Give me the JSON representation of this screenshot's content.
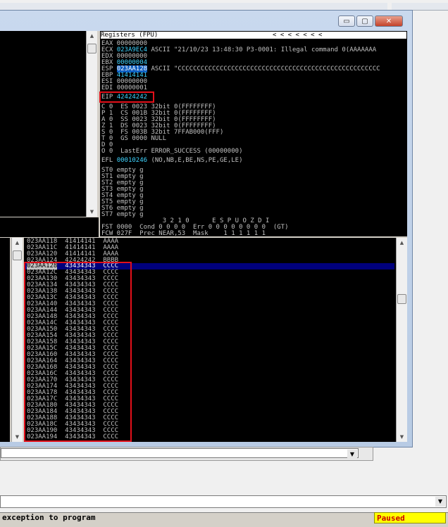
{
  "window_buttons": {
    "minimize": "▭",
    "restore": "▢",
    "close": "✕"
  },
  "registers": {
    "header": "Registers (FPU)",
    "header_arrows": "<    <    <    <    <    <    <",
    "lines": [
      {
        "text": "EAX 00000000"
      },
      {
        "name": "ECX",
        "value": "023A9EC4",
        "rest": " ASCII \"21/10/23 13:48:30 P3-0001: Illegal command 0(AAAAAAA"
      },
      {
        "text": "EDX 00000000"
      },
      {
        "name": "EBX",
        "value": "00000004",
        "rest": ""
      },
      {
        "name": "ESP",
        "value": "023AA128",
        "rest": " ASCII \"CCCCCCCCCCCCCCCCCCCCCCCCCCCCCCCCCCCCCCCCCCCCCCCCCCCCC"
      },
      {
        "name": "EBP",
        "value": "41414141",
        "rest": ""
      },
      {
        "name": "ESI",
        "value": "00000000",
        "rest": ""
      },
      {
        "name": "EDI",
        "value": "00000001",
        "rest": ""
      }
    ],
    "eip": {
      "name": "EIP",
      "value": "42424242"
    },
    "flags": [
      "C 0  ES 0023 32bit 0(FFFFFFFF)",
      "P 1  CS 001B 32bit 0(FFFFFFFF)",
      "A 0  SS 0023 32bit 0(FFFFFFFF)",
      "Z 1  DS 0023 32bit 0(FFFFFFFF)",
      "S 0  FS 003B 32bit 7FFAB000(FFF)",
      "T 0  GS 0000 NULL",
      "D 0",
      "O 0  LastErr ERROR_SUCCESS (00000000)"
    ],
    "efl": {
      "name": "EFL",
      "value": "00010246",
      "rest": " (NO,NB,E,BE,NS,PE,GE,LE)"
    },
    "fpu": [
      "ST0 empty g",
      "ST1 empty g",
      "ST2 empty g",
      "ST3 empty g",
      "ST4 empty g",
      "ST5 empty g",
      "ST6 empty g",
      "ST7 empty g"
    ],
    "fpu_bottom": [
      "                3 2 1 0      E S P U O Z D I",
      "FST 0000  Cond 0 0 0 0  Err 0 0 0 0 0 0 0 0  (GT)",
      "FCW 027F  Prec NEAR,53  Mask    1 1 1 1 1 1"
    ]
  },
  "stack": {
    "above": [
      "023AA118  41414141  AAAA",
      "023AA11C  41414141  AAAA",
      "023AA120  41414141  AAAA",
      "023AA124  42424242  BBBB"
    ],
    "selected_addr": "023AA128",
    "selected_rest": "  43434343  CCCC",
    "rows": [
      "023AA12C  43434343  CCCC",
      "023AA130  43434343  CCCC",
      "023AA134  43434343  CCCC",
      "023AA138  43434343  CCCC",
      "023AA13C  43434343  CCCC",
      "023AA140  43434343  CCCC",
      "023AA144  43434343  CCCC",
      "023AA148  43434343  CCCC",
      "023AA14C  43434343  CCCC",
      "023AA150  43434343  CCCC",
      "023AA154  43434343  CCCC",
      "023AA158  43434343  CCCC",
      "023AA15C  43434343  CCCC",
      "023AA160  43434343  CCCC",
      "023AA164  43434343  CCCC",
      "023AA168  43434343  CCCC",
      "023AA16C  43434343  CCCC",
      "023AA170  43434343  CCCC",
      "023AA174  43434343  CCCC",
      "023AA178  43434343  CCCC",
      "023AA17C  43434343  CCCC",
      "023AA180  43434343  CCCC",
      "023AA184  43434343  CCCC",
      "023AA188  43434343  CCCC",
      "023AA18C  43434343  CCCC",
      "023AA190  43434343  CCCC",
      "023AA194  43434343  CCCC"
    ]
  },
  "status": {
    "message": "exception to program",
    "state": "Paused"
  },
  "colors": {
    "highlight_box": "#e3101a",
    "selected_row": "#00007c",
    "paused_bg": "#ffff00",
    "paused_fg": "#cc0000"
  }
}
